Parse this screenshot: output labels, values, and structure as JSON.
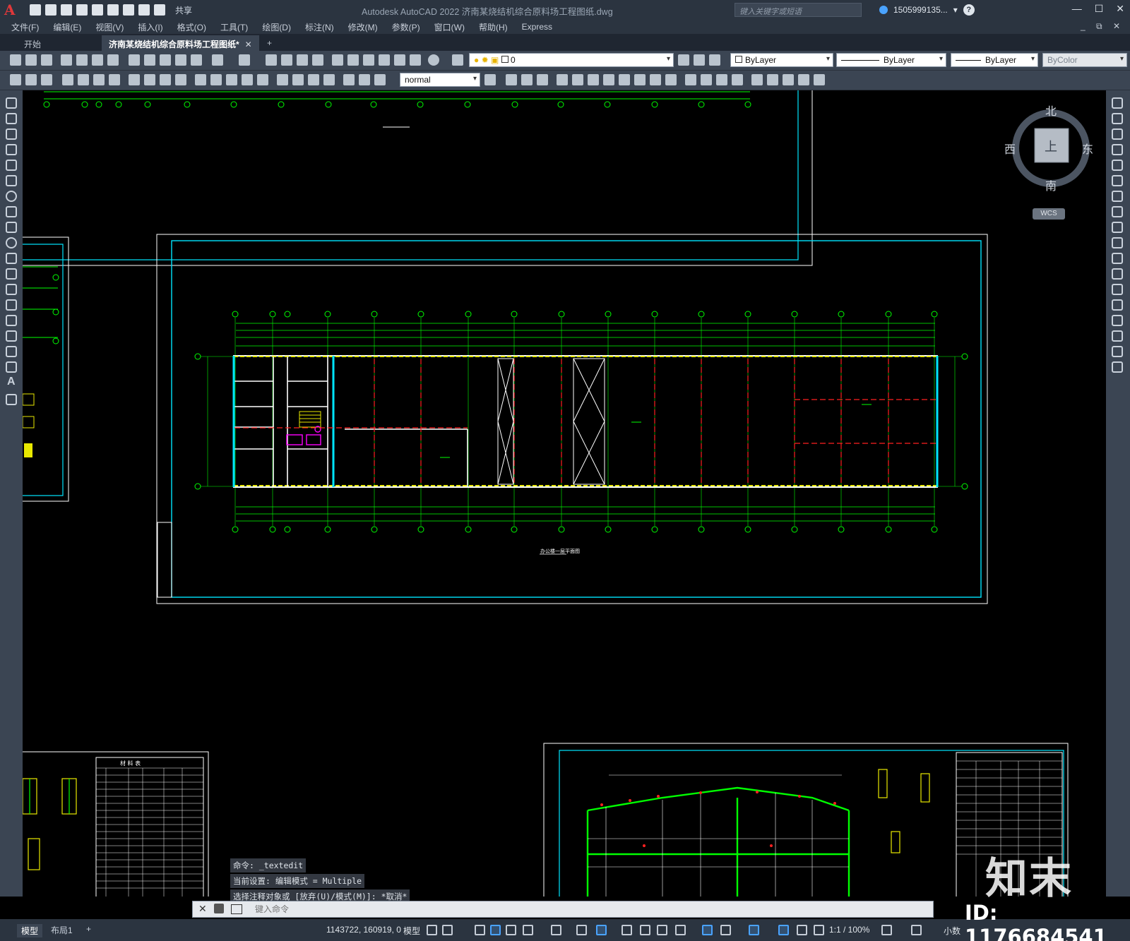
{
  "app": {
    "title": "Autodesk AutoCAD 2022    济南某烧结机综合原料场工程图纸.dwg",
    "logo": "A",
    "share_label": "共享",
    "search_placeholder": "键入关键字或短语",
    "user": "1505999135...",
    "help": "?"
  },
  "menu": [
    "文件(F)",
    "编辑(E)",
    "视图(V)",
    "插入(I)",
    "格式(O)",
    "工具(T)",
    "绘图(D)",
    "标注(N)",
    "修改(M)",
    "参数(P)",
    "窗口(W)",
    "帮助(H)",
    "Express"
  ],
  "tabs": [
    {
      "label": "开始"
    },
    {
      "label": "济南某烧结机综合原料场工程图纸*"
    }
  ],
  "toolbar": {
    "layer": "0",
    "color": "ByLayer",
    "linetype": "ByLayer",
    "lineweight": "ByLayer",
    "plotstyle": "ByColor",
    "textstyle": "normal"
  },
  "viewcube": {
    "north": "北",
    "south": "南",
    "east": "东",
    "west": "西",
    "face": "上",
    "wcs": "WCS"
  },
  "command": {
    "history": [
      "命令: _textedit",
      "当前设置: 编辑模式 = Multiple",
      "选择注释对象或 [放弃(U)/模式(M)]: *取消*"
    ],
    "placeholder": "键入命令"
  },
  "status": {
    "model_tab": "模型",
    "layout_tab": "布局1",
    "coords": "1143722, 160919, 0",
    "space": "模型",
    "scale": "1:1 / 100%",
    "units": "小数"
  },
  "drawing": {
    "plan_title": "办公楼一层平面图",
    "table_title": "材 料 表"
  },
  "watermark": {
    "brand": "知末",
    "id": "ID: 1176684541"
  }
}
